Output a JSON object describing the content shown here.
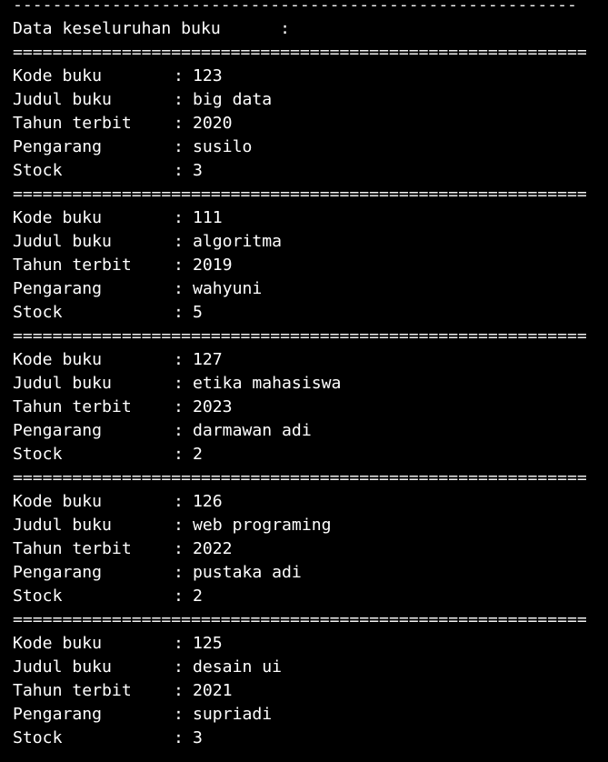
{
  "terminal": {
    "top_separator": "---------------------------------------------------------",
    "header_label": "Data keseluruhan buku",
    "header_colon": ":",
    "separator": "==========================================================",
    "field_labels": {
      "kode": "Kode buku",
      "judul": "Judul buku",
      "tahun": "Tahun terbit",
      "pengarang": "Pengarang",
      "stock": "Stock"
    },
    "colon": ":",
    "books": [
      {
        "kode": "123",
        "judul": "big data",
        "tahun": "2020",
        "pengarang": "susilo",
        "stock": "3"
      },
      {
        "kode": "111",
        "judul": "algoritma",
        "tahun": "2019",
        "pengarang": "wahyuni",
        "stock": "5"
      },
      {
        "kode": "127",
        "judul": "etika mahasiswa",
        "tahun": "2023",
        "pengarang": "darmawan adi",
        "stock": "2"
      },
      {
        "kode": "126",
        "judul": "web programing",
        "tahun": "2022",
        "pengarang": "pustaka adi",
        "stock": "2"
      },
      {
        "kode": "125",
        "judul": "desain ui",
        "tahun": "2021",
        "pengarang": "supriadi",
        "stock": "3"
      }
    ]
  }
}
